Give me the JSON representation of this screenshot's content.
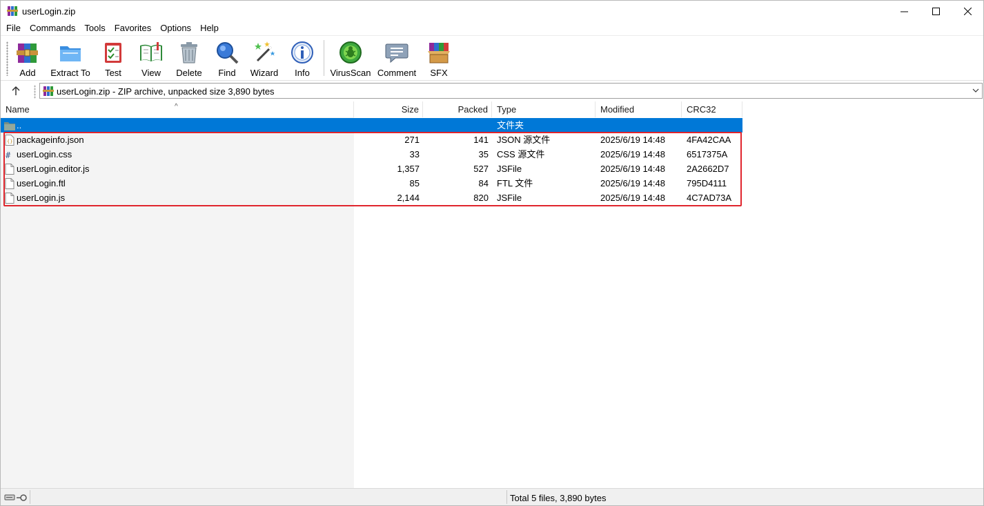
{
  "window": {
    "title": "userLogin.zip"
  },
  "menu": [
    "File",
    "Commands",
    "Tools",
    "Favorites",
    "Options",
    "Help"
  ],
  "toolbar": {
    "buttons": [
      {
        "label": "Add",
        "icon": "add-icon"
      },
      {
        "label": "Extract To",
        "icon": "extract-folder-icon"
      },
      {
        "label": "Test",
        "icon": "test-checklist-icon"
      },
      {
        "label": "View",
        "icon": "view-book-icon"
      },
      {
        "label": "Delete",
        "icon": "trash-icon"
      },
      {
        "label": "Find",
        "icon": "magnifier-icon"
      },
      {
        "label": "Wizard",
        "icon": "magic-wand-icon"
      },
      {
        "label": "Info",
        "icon": "info-icon"
      },
      {
        "label": "VirusScan",
        "icon": "virus-scan-icon"
      },
      {
        "label": "Comment",
        "icon": "comment-icon"
      },
      {
        "label": "SFX",
        "icon": "sfx-box-icon"
      }
    ]
  },
  "address": {
    "text": "userLogin.zip - ZIP archive, unpacked size 3,890 bytes"
  },
  "columns": {
    "name": "Name",
    "size": "Size",
    "packed": "Packed",
    "type": "Type",
    "modified": "Modified",
    "crc": "CRC32"
  },
  "parent_row": {
    "name": "..",
    "type": "文件夹"
  },
  "files": [
    {
      "name": "packageinfo.json",
      "size": "271",
      "packed": "141",
      "type": "JSON 源文件",
      "modified": "2025/6/19 14:48",
      "crc": "4FA42CAA"
    },
    {
      "name": "userLogin.css",
      "size": "33",
      "packed": "35",
      "type": "CSS 源文件",
      "modified": "2025/6/19 14:48",
      "crc": "6517375A"
    },
    {
      "name": "userLogin.editor.js",
      "size": "1,357",
      "packed": "527",
      "type": "JSFile",
      "modified": "2025/6/19 14:48",
      "crc": "2A2662D7"
    },
    {
      "name": "userLogin.ftl",
      "size": "85",
      "packed": "84",
      "type": "FTL 文件",
      "modified": "2025/6/19 14:48",
      "crc": "795D4111"
    },
    {
      "name": "userLogin.js",
      "size": "2,144",
      "packed": "820",
      "type": "JSFile",
      "modified": "2025/6/19 14:48",
      "crc": "4C7AD73A"
    }
  ],
  "status": {
    "text": "Total 5 files, 3,890 bytes"
  },
  "colors": {
    "selection": "#0078d7",
    "highlight_border": "#e0242c"
  }
}
